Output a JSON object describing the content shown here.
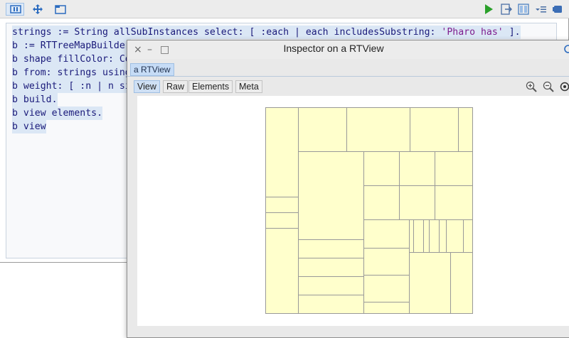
{
  "playground": {
    "toolbar": {
      "left_buttons": [
        {
          "name": "playground-tab-icon",
          "selected": true
        },
        {
          "name": "move-icon",
          "selected": false
        },
        {
          "name": "folder-icon",
          "selected": false
        }
      ],
      "right_buttons": [
        "play-icon",
        "do-it-and-go-icon",
        "bindings-icon",
        "menu-icon",
        "stop-icon"
      ],
      "colors": {
        "play": "#2aa02a"
      }
    },
    "code_lines": [
      {
        "parts": [
          "strings := String allSubInstances select: [ :each | each includesSubstring: ",
          "'Pharo has'",
          " ]."
        ]
      },
      {
        "parts": [
          "b := RTTreeMapBuilder"
        ]
      },
      {
        "parts": [
          "b shape fillColor: Co"
        ]
      },
      {
        "parts": [
          "b from: strings using"
        ]
      },
      {
        "parts": [
          "b weight: [ :n | n si"
        ]
      },
      {
        "parts": [
          "b build."
        ]
      },
      {
        "parts": [
          "b view elements."
        ]
      },
      {
        "parts": [
          "b view"
        ]
      }
    ]
  },
  "inspector": {
    "title": "Inspector on a RTView",
    "controls": {
      "close": "×",
      "minimize": "–",
      "maximize": "□"
    },
    "pager_label": "a RTView",
    "tabs": [
      "View",
      "Raw",
      "Elements",
      "Meta"
    ],
    "selected_tab": "View",
    "zoom_buttons": [
      "zoom-in-icon",
      "zoom-out-icon",
      "zoom-reset-icon"
    ],
    "treemap": {
      "fill": "#ffffcc",
      "stroke": "#999999"
    }
  }
}
